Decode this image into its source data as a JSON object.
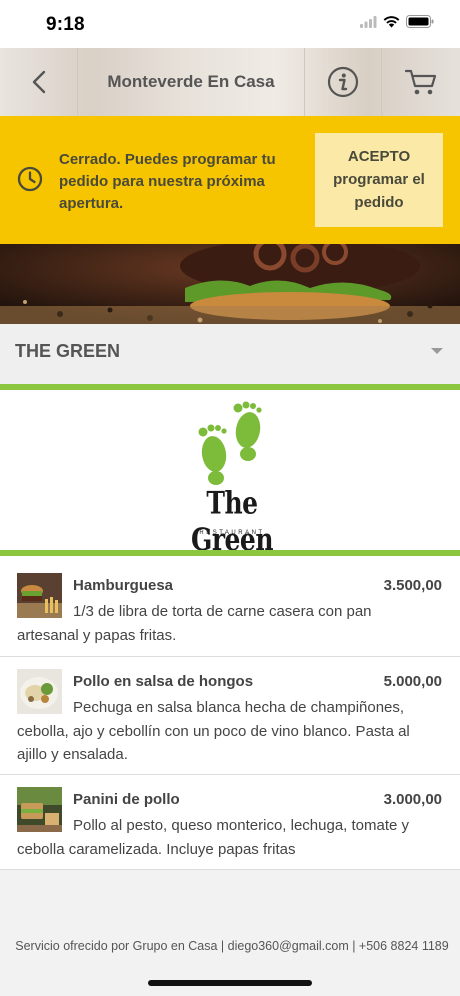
{
  "status_bar": {
    "time": "9:18"
  },
  "nav": {
    "title": "Monteverde En Casa"
  },
  "banner": {
    "closed_text": "Cerrado. Puedes programar tu pedido para nuestra próxima apertura.",
    "accept_line1": "ACEPTO",
    "accept_line2": "programar el",
    "accept_line3": "pedido"
  },
  "category": {
    "title": "THE GREEN"
  },
  "logo": {
    "name": "The Green",
    "tagline": "RESTAURANT"
  },
  "menu": [
    {
      "name": "Hamburguesa",
      "price": "3.500,00",
      "description": "1/3 de libra de torta de carne casera con pan artesanal y papas fritas."
    },
    {
      "name": "Pollo en salsa de hongos",
      "price": "5.000,00",
      "description": "Pechuga en salsa blanca hecha de champiñones, cebolla, ajo y cebollín con un poco de vino blanco. Pasta al ajillo y ensalada."
    },
    {
      "name": "Panini de pollo",
      "price": "3.000,00",
      "description": "Pollo al pesto, queso monterico, lechuga, tomate y cebolla caramelizada. Incluye papas fritas"
    }
  ],
  "footer": {
    "text": "Servicio ofrecido por Grupo en Casa | diego360@gmail.com | +506 8824 1189"
  },
  "colors": {
    "banner": "#f6c500",
    "accent_green": "#8cc63f",
    "accept_button": "#fbe9a8"
  },
  "icons": [
    "wifi-icon",
    "signal-icon",
    "battery-icon",
    "back-chevron-icon",
    "info-icon",
    "cart-icon",
    "clock-icon",
    "caret-down-icon",
    "footprints-icon"
  ]
}
